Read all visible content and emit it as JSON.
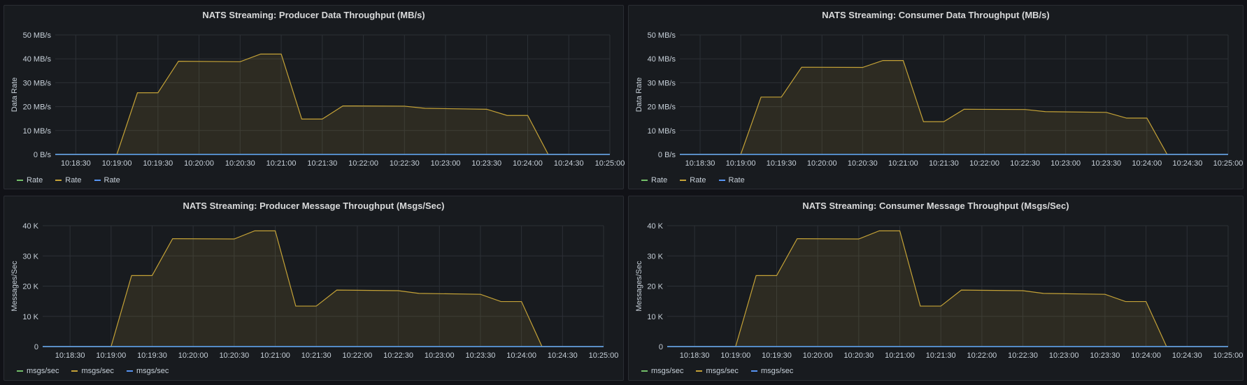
{
  "colors": {
    "series_green": "#73bf69",
    "series_yellow": "#c4a237",
    "series_blue": "#5794f2",
    "grid": "#2c3036",
    "axis_text": "#c7d0d9"
  },
  "chart_data": [
    {
      "type": "area",
      "title": "NATS Streaming: Producer Data Throughput (MB/s)",
      "ylabel": "Data Rate",
      "xlabel": "",
      "x_range": [
        "10:18:15",
        "10:25:00"
      ],
      "ylim": [
        0,
        50
      ],
      "y_unit": "MB/s",
      "y_ticks": [
        "0 B/s",
        "10 MB/s",
        "20 MB/s",
        "30 MB/s",
        "40 MB/s",
        "50 MB/s"
      ],
      "x_ticks": [
        "10:18:30",
        "10:19:00",
        "10:19:30",
        "10:20:00",
        "10:20:30",
        "10:21:00",
        "10:21:30",
        "10:22:00",
        "10:22:30",
        "10:23:00",
        "10:23:30",
        "10:24:00",
        "10:24:30",
        "10:25:00"
      ],
      "grid": true,
      "legend_position": "bottom-left",
      "series": [
        {
          "name": "Rate",
          "color": "#73bf69",
          "x": [
            "10:18:15",
            "10:25:00"
          ],
          "values": [
            0,
            0
          ]
        },
        {
          "name": "Rate",
          "color": "#c4a237",
          "x": [
            "10:18:15",
            "10:19:00",
            "10:19:15",
            "10:19:30",
            "10:19:45",
            "10:20:30",
            "10:20:45",
            "10:21:00",
            "10:21:15",
            "10:21:30",
            "10:21:45",
            "10:22:30",
            "10:22:45",
            "10:23:30",
            "10:23:45",
            "10:24:00",
            "10:24:15",
            "10:25:00"
          ],
          "values": [
            0,
            0,
            25.8,
            25.8,
            39,
            38.8,
            42,
            42,
            14.8,
            14.8,
            20.3,
            20.2,
            19.3,
            18.9,
            16.3,
            16.3,
            0,
            0
          ]
        },
        {
          "name": "Rate",
          "color": "#5794f2",
          "x": [
            "10:18:15",
            "10:25:00"
          ],
          "values": [
            0,
            0
          ]
        }
      ]
    },
    {
      "type": "area",
      "title": "NATS Streaming: Consumer Data Throughput (MB/s)",
      "ylabel": "Data Rate",
      "xlabel": "",
      "x_range": [
        "10:18:15",
        "10:25:00"
      ],
      "ylim": [
        0,
        50
      ],
      "y_unit": "MB/s",
      "y_ticks": [
        "0 B/s",
        "10 MB/s",
        "20 MB/s",
        "30 MB/s",
        "40 MB/s",
        "50 MB/s"
      ],
      "x_ticks": [
        "10:18:30",
        "10:19:00",
        "10:19:30",
        "10:20:00",
        "10:20:30",
        "10:21:00",
        "10:21:30",
        "10:22:00",
        "10:22:30",
        "10:23:00",
        "10:23:30",
        "10:24:00",
        "10:24:30",
        "10:25:00"
      ],
      "grid": true,
      "legend_position": "bottom-left",
      "series": [
        {
          "name": "Rate",
          "color": "#73bf69",
          "x": [
            "10:18:15",
            "10:25:00"
          ],
          "values": [
            0,
            0
          ]
        },
        {
          "name": "Rate",
          "color": "#c4a237",
          "x": [
            "10:18:15",
            "10:19:00",
            "10:19:15",
            "10:19:30",
            "10:19:45",
            "10:20:30",
            "10:20:45",
            "10:21:00",
            "10:21:15",
            "10:21:30",
            "10:21:45",
            "10:22:30",
            "10:22:45",
            "10:23:30",
            "10:23:45",
            "10:24:00",
            "10:24:15",
            "10:25:00"
          ],
          "values": [
            0,
            0,
            24,
            24,
            36.5,
            36.4,
            39.3,
            39.3,
            13.7,
            13.7,
            18.9,
            18.8,
            17.9,
            17.6,
            15.2,
            15.2,
            0,
            0
          ]
        },
        {
          "name": "Rate",
          "color": "#5794f2",
          "x": [
            "10:18:15",
            "10:25:00"
          ],
          "values": [
            0,
            0
          ]
        }
      ]
    },
    {
      "type": "area",
      "title": "NATS Streaming: Producer Message Throughput (Msgs/Sec)",
      "ylabel": "Messages/Sec",
      "xlabel": "",
      "x_range": [
        "10:18:10",
        "10:25:00"
      ],
      "ylim": [
        0,
        40000
      ],
      "y_ticks": [
        "0",
        "10 K",
        "20 K",
        "30 K",
        "40 K"
      ],
      "x_ticks": [
        "10:18:30",
        "10:19:00",
        "10:19:30",
        "10:20:00",
        "10:20:30",
        "10:21:00",
        "10:21:30",
        "10:22:00",
        "10:22:30",
        "10:23:00",
        "10:23:30",
        "10:24:00",
        "10:24:30",
        "10:25:00"
      ],
      "grid": true,
      "legend_position": "bottom-left",
      "series": [
        {
          "name": "msgs/sec",
          "color": "#73bf69",
          "x": [
            "10:18:10",
            "10:25:00"
          ],
          "values": [
            0,
            0
          ]
        },
        {
          "name": "msgs/sec",
          "color": "#c4a237",
          "x": [
            "10:18:10",
            "10:19:00",
            "10:19:15",
            "10:19:30",
            "10:19:45",
            "10:20:30",
            "10:20:45",
            "10:21:00",
            "10:21:15",
            "10:21:30",
            "10:21:45",
            "10:22:30",
            "10:22:45",
            "10:23:30",
            "10:23:45",
            "10:24:00",
            "10:24:15",
            "10:25:00"
          ],
          "values": [
            0,
            0,
            23500,
            23500,
            35700,
            35600,
            38300,
            38300,
            13400,
            13400,
            18700,
            18500,
            17600,
            17300,
            14900,
            14900,
            0,
            0
          ]
        },
        {
          "name": "msgs/sec",
          "color": "#5794f2",
          "x": [
            "10:18:10",
            "10:25:00"
          ],
          "values": [
            0,
            0
          ]
        }
      ]
    },
    {
      "type": "area",
      "title": "NATS Streaming: Consumer Message Throughput (Msgs/Sec)",
      "ylabel": "Messages/Sec",
      "xlabel": "",
      "x_range": [
        "10:18:10",
        "10:25:00"
      ],
      "ylim": [
        0,
        40000
      ],
      "y_ticks": [
        "0",
        "10 K",
        "20 K",
        "30 K",
        "40 K"
      ],
      "x_ticks": [
        "10:18:30",
        "10:19:00",
        "10:19:30",
        "10:20:00",
        "10:20:30",
        "10:21:00",
        "10:21:30",
        "10:22:00",
        "10:22:30",
        "10:23:00",
        "10:23:30",
        "10:24:00",
        "10:24:30",
        "10:25:00"
      ],
      "grid": true,
      "legend_position": "bottom-left",
      "series": [
        {
          "name": "msgs/sec",
          "color": "#73bf69",
          "x": [
            "10:18:10",
            "10:25:00"
          ],
          "values": [
            0,
            0
          ]
        },
        {
          "name": "msgs/sec",
          "color": "#c4a237",
          "x": [
            "10:18:10",
            "10:19:00",
            "10:19:15",
            "10:19:30",
            "10:19:45",
            "10:20:30",
            "10:20:45",
            "10:21:00",
            "10:21:15",
            "10:21:30",
            "10:21:45",
            "10:22:30",
            "10:22:45",
            "10:23:30",
            "10:23:45",
            "10:24:00",
            "10:24:15",
            "10:25:00"
          ],
          "values": [
            0,
            0,
            23500,
            23500,
            35700,
            35600,
            38300,
            38300,
            13400,
            13400,
            18700,
            18500,
            17600,
            17300,
            14900,
            14900,
            0,
            0
          ]
        },
        {
          "name": "msgs/sec",
          "color": "#5794f2",
          "x": [
            "10:18:10",
            "10:25:00"
          ],
          "values": [
            0,
            0
          ]
        }
      ]
    }
  ]
}
